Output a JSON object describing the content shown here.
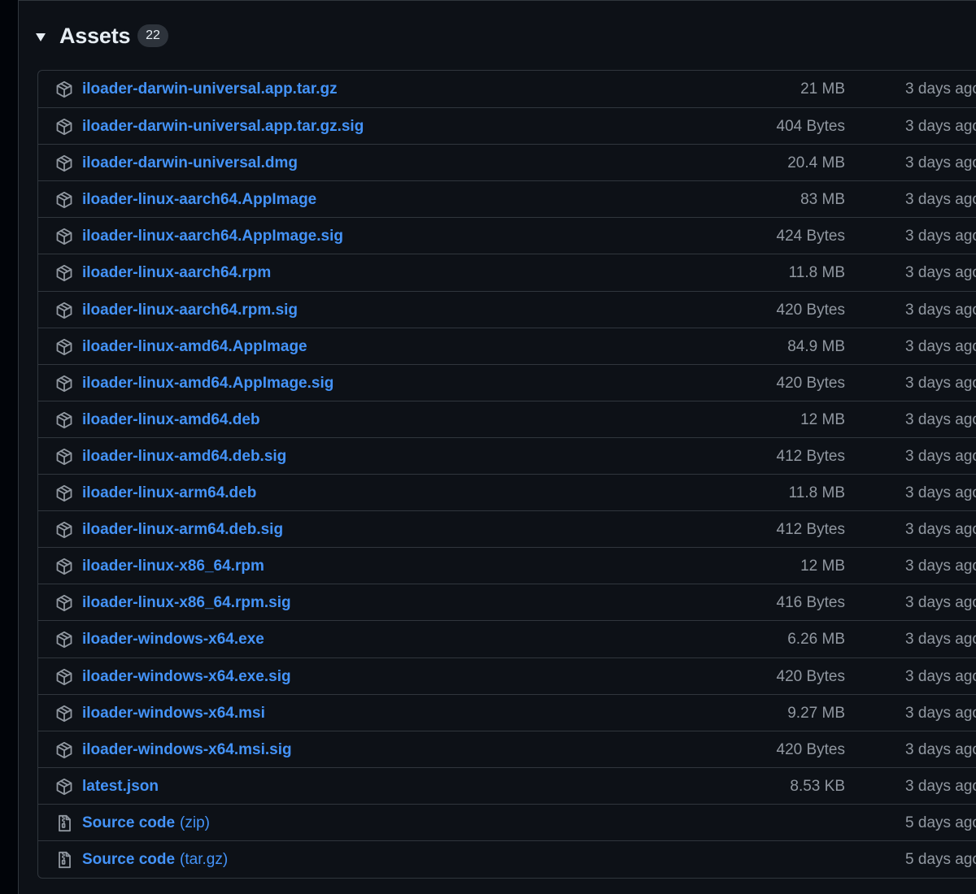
{
  "assets": {
    "title": "Assets",
    "count": "22",
    "items": [
      {
        "name": "iloader-darwin-universal.app.tar.gz",
        "size": "21 MB",
        "time": "3 days ago",
        "icon": "package-icon"
      },
      {
        "name": "iloader-darwin-universal.app.tar.gz.sig",
        "size": "404 Bytes",
        "time": "3 days ago",
        "icon": "package-icon"
      },
      {
        "name": "iloader-darwin-universal.dmg",
        "size": "20.4 MB",
        "time": "3 days ago",
        "icon": "package-icon"
      },
      {
        "name": "iloader-linux-aarch64.AppImage",
        "size": "83 MB",
        "time": "3 days ago",
        "icon": "package-icon"
      },
      {
        "name": "iloader-linux-aarch64.AppImage.sig",
        "size": "424 Bytes",
        "time": "3 days ago",
        "icon": "package-icon"
      },
      {
        "name": "iloader-linux-aarch64.rpm",
        "size": "11.8 MB",
        "time": "3 days ago",
        "icon": "package-icon"
      },
      {
        "name": "iloader-linux-aarch64.rpm.sig",
        "size": "420 Bytes",
        "time": "3 days ago",
        "icon": "package-icon"
      },
      {
        "name": "iloader-linux-amd64.AppImage",
        "size": "84.9 MB",
        "time": "3 days ago",
        "icon": "package-icon"
      },
      {
        "name": "iloader-linux-amd64.AppImage.sig",
        "size": "420 Bytes",
        "time": "3 days ago",
        "icon": "package-icon"
      },
      {
        "name": "iloader-linux-amd64.deb",
        "size": "12 MB",
        "time": "3 days ago",
        "icon": "package-icon"
      },
      {
        "name": "iloader-linux-amd64.deb.sig",
        "size": "412 Bytes",
        "time": "3 days ago",
        "icon": "package-icon"
      },
      {
        "name": "iloader-linux-arm64.deb",
        "size": "11.8 MB",
        "time": "3 days ago",
        "icon": "package-icon"
      },
      {
        "name": "iloader-linux-arm64.deb.sig",
        "size": "412 Bytes",
        "time": "3 days ago",
        "icon": "package-icon"
      },
      {
        "name": "iloader-linux-x86_64.rpm",
        "size": "12 MB",
        "time": "3 days ago",
        "icon": "package-icon"
      },
      {
        "name": "iloader-linux-x86_64.rpm.sig",
        "size": "416 Bytes",
        "time": "3 days ago",
        "icon": "package-icon"
      },
      {
        "name": "iloader-windows-x64.exe",
        "size": "6.26 MB",
        "time": "3 days ago",
        "icon": "package-icon"
      },
      {
        "name": "iloader-windows-x64.exe.sig",
        "size": "420 Bytes",
        "time": "3 days ago",
        "icon": "package-icon"
      },
      {
        "name": "iloader-windows-x64.msi",
        "size": "9.27 MB",
        "time": "3 days ago",
        "icon": "package-icon"
      },
      {
        "name": "iloader-windows-x64.msi.sig",
        "size": "420 Bytes",
        "time": "3 days ago",
        "icon": "package-icon"
      },
      {
        "name": "latest.json",
        "size": "8.53 KB",
        "time": "3 days ago",
        "icon": "package-icon"
      },
      {
        "name": "Source code",
        "suffix": "(zip)",
        "size": "",
        "time": "5 days ago",
        "icon": "file-zip-icon"
      },
      {
        "name": "Source code",
        "suffix": "(tar.gz)",
        "size": "",
        "time": "5 days ago",
        "icon": "file-zip-icon"
      }
    ]
  },
  "colors": {
    "background": "#0d1117",
    "page_background": "#010409",
    "border": "#30363d",
    "link": "#4493f8",
    "muted_text": "#9198a1",
    "primary_text": "#e6edf3",
    "badge_background": "#2d333b"
  }
}
